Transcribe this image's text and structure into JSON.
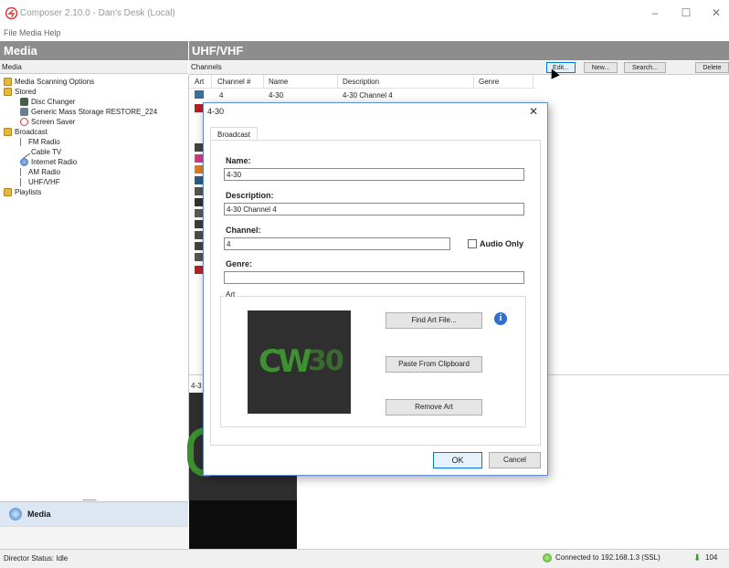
{
  "window": {
    "title": "Composer 2.10.0 - Dan's Desk (Local)",
    "logo_icon": "composer-logo-icon",
    "controls": {
      "minimize": "–",
      "maximize": "☐",
      "close": "✕"
    }
  },
  "menubar": {
    "items": [
      "File",
      "Media",
      "Help"
    ]
  },
  "left": {
    "header": "Media",
    "sub": "Media",
    "tree": [
      {
        "label": "Media Scanning Options",
        "icon": "folder-icon"
      },
      {
        "label": "Stored",
        "icon": "folder-icon"
      },
      {
        "label": "Disc Changer",
        "icon": "disc-changer-icon"
      },
      {
        "label": "Generic Mass Storage RESTORE_224",
        "icon": "storage-icon"
      },
      {
        "label": "Screen Saver",
        "icon": "screensaver-icon"
      },
      {
        "label": "Broadcast",
        "icon": "folder-icon"
      },
      {
        "label": "FM Radio",
        "icon": "antenna-icon"
      },
      {
        "label": "Cable TV",
        "icon": "cable-icon"
      },
      {
        "label": "Internet Radio",
        "icon": "globe-icon"
      },
      {
        "label": "AM Radio",
        "icon": "antenna-icon"
      },
      {
        "label": "UHF/VHF",
        "icon": "antenna-icon"
      },
      {
        "label": "Playlists",
        "icon": "folder-icon"
      }
    ],
    "nav_dots": "..........",
    "nav_media": "Media"
  },
  "right": {
    "header": "UHF/VHF",
    "channels_label": "Channels",
    "buttons": {
      "edit": "Edit...",
      "new": "New...",
      "search": "Search...",
      "delete": "Delete"
    },
    "columns": [
      "Art",
      "Channel #",
      "Name",
      "Description",
      "Genre"
    ],
    "row": {
      "channel": "4",
      "name": "4-30",
      "description": "4-30 Channel 4"
    },
    "preview_label": "4-3"
  },
  "dialog": {
    "title": "4-30",
    "close": "✕",
    "tab": "Broadcast",
    "name_label": "Name:",
    "name_value": "4-30",
    "description_label": "Description:",
    "description_value": "4-30 Channel 4",
    "channel_label": "Channel:",
    "channel_value": "4",
    "audio_only_label": "Audio Only",
    "genre_label": "Genre:",
    "genre_value": "",
    "art_label": "Art",
    "art_text_cw": "CW",
    "art_text_num": "30",
    "find_art": "Find Art File...",
    "info": "i",
    "paste": "Paste From Clipboard",
    "remove": "Remove Art",
    "ok": "OK",
    "cancel": "Cancel"
  },
  "status": {
    "text": "Director Status: Idle",
    "connection": "Connected to 192.168.1.3 (SSL)",
    "count": "104"
  },
  "colors": {
    "accent": "#0078d7",
    "header_gray": "#8d8d8d",
    "cw_green": "#3d9131"
  }
}
